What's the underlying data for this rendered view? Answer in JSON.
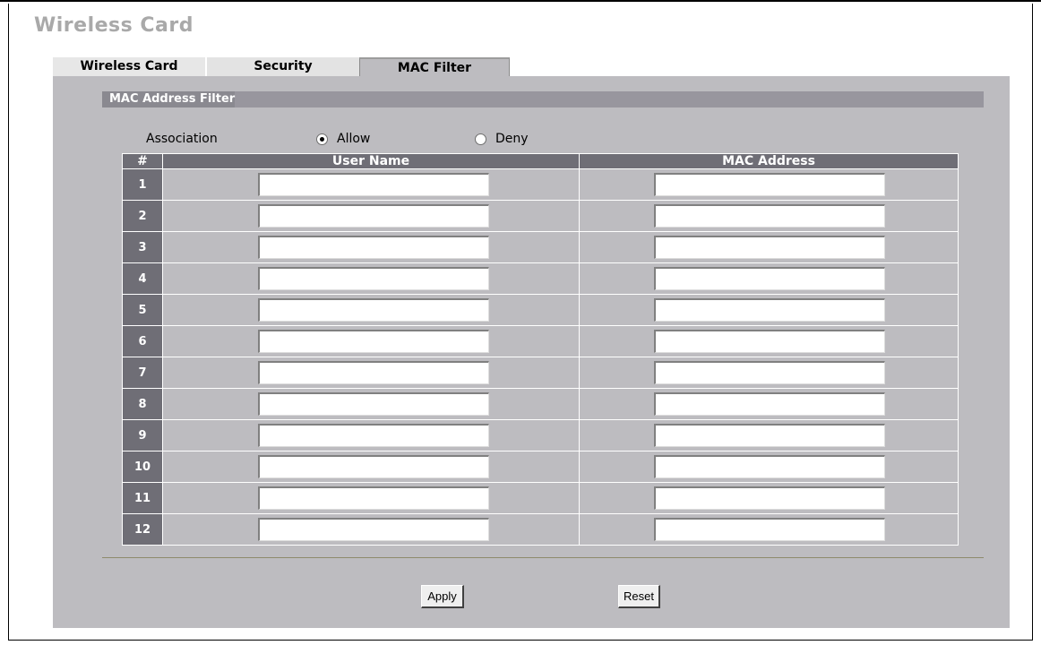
{
  "page": {
    "title": "Wireless Card"
  },
  "tabs": [
    {
      "label": "Wireless Card",
      "active": false
    },
    {
      "label": "Security",
      "active": false
    },
    {
      "label": "MAC Filter",
      "active": true
    }
  ],
  "section": {
    "title": "MAC Address Filter"
  },
  "association": {
    "label": "Association",
    "options": [
      "Allow",
      "Deny"
    ],
    "selected": "Allow"
  },
  "table": {
    "headers": [
      "#",
      "User Name",
      "MAC Address"
    ],
    "rows": [
      {
        "index": "1",
        "user_name": "",
        "mac_address": ""
      },
      {
        "index": "2",
        "user_name": "",
        "mac_address": ""
      },
      {
        "index": "3",
        "user_name": "",
        "mac_address": ""
      },
      {
        "index": "4",
        "user_name": "",
        "mac_address": ""
      },
      {
        "index": "5",
        "user_name": "",
        "mac_address": ""
      },
      {
        "index": "6",
        "user_name": "",
        "mac_address": ""
      },
      {
        "index": "7",
        "user_name": "",
        "mac_address": ""
      },
      {
        "index": "8",
        "user_name": "",
        "mac_address": ""
      },
      {
        "index": "9",
        "user_name": "",
        "mac_address": ""
      },
      {
        "index": "10",
        "user_name": "",
        "mac_address": ""
      },
      {
        "index": "11",
        "user_name": "",
        "mac_address": ""
      },
      {
        "index": "12",
        "user_name": "",
        "mac_address": ""
      }
    ]
  },
  "buttons": {
    "apply": "Apply",
    "reset": "Reset"
  },
  "colors": {
    "panel": "#bdbcc0",
    "header": "#6f6e76",
    "section_bar": "#98969e",
    "title_gray": "#a9a9a9"
  }
}
